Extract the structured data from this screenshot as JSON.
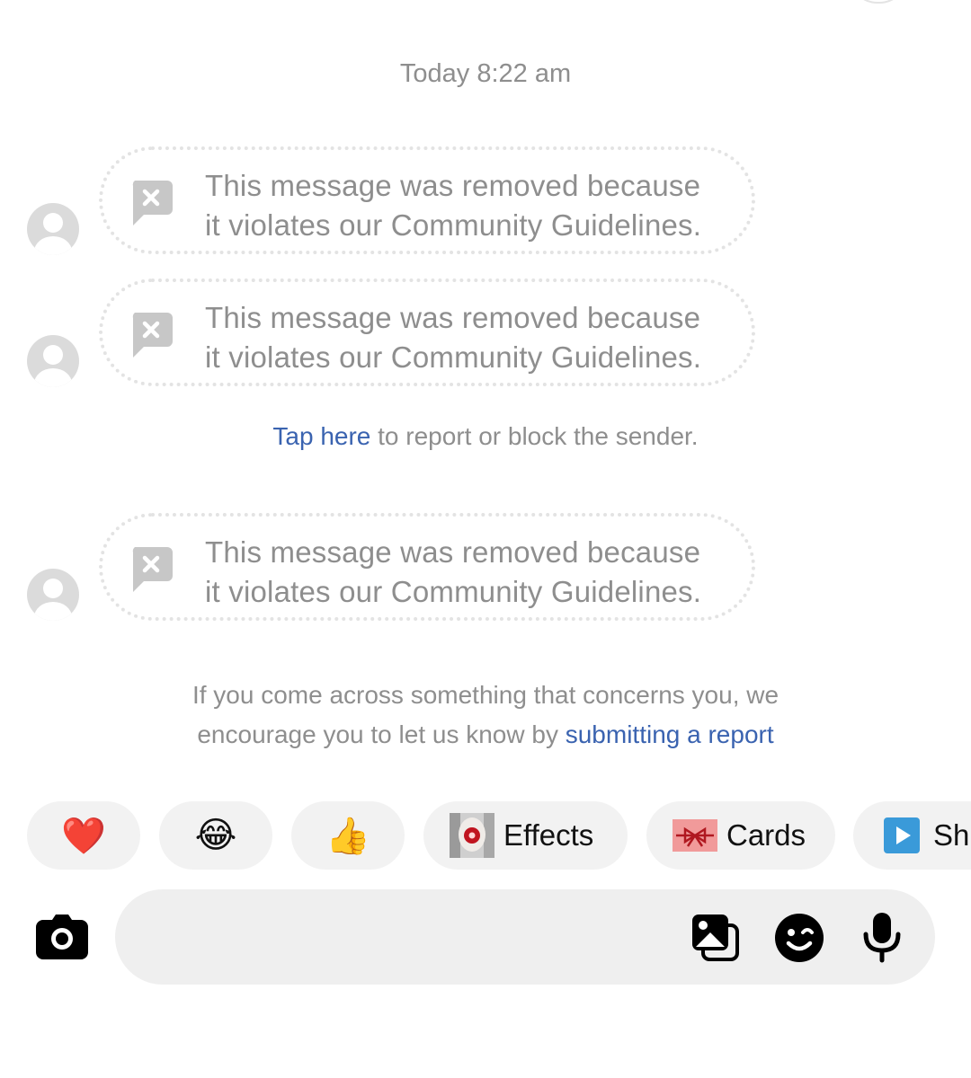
{
  "thread": {
    "timestamp": "Today 8:22 am",
    "removed_messages": [
      {
        "line1": "This message was removed because",
        "line2": "it violates our Community Guidelines."
      },
      {
        "line1": "This message was removed because",
        "line2": "it violates our Community Guidelines."
      },
      {
        "line1": "This message was removed because",
        "line2": "it violates our Community Guidelines."
      }
    ],
    "report_prompt": {
      "link_text": "Tap here",
      "rest_text": " to report or block the sender."
    },
    "notice": {
      "line1": "If you come across something that concerns you, we",
      "line2_text": "encourage you to let us know by ",
      "line2_link": "submitting a report"
    }
  },
  "quick_reactions": {
    "heart": "❤️",
    "laugh": "😂",
    "thumbs_up": "👍",
    "effects_label": "Effects",
    "cards_label": "Cards",
    "sh_label": "Sh"
  },
  "composer": {
    "camera_icon": "camera-icon",
    "gallery_icon": "gallery-icon",
    "sticker_icon": "sticker-icon",
    "mic_icon": "microphone-icon"
  },
  "colors": {
    "muted_text": "#8e8e8e",
    "link": "#3a63b0",
    "chip_bg": "#f2f2f2",
    "composer_bg": "#efefef",
    "heart_red": "#e0162b"
  }
}
